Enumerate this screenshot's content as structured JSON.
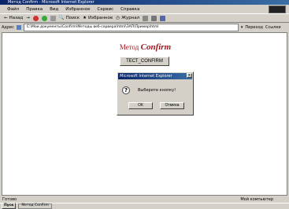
{
  "window": {
    "title": "Метод Confirm - Microsoft Internet Explorer"
  },
  "menu": [
    "Файл",
    "Правка",
    "Вид",
    "Избранное",
    "Сервис",
    "Справка"
  ],
  "toolbar": {
    "back": "Назад",
    "search": "Поиск",
    "favorites": "Избранное",
    "journal": "Журнал"
  },
  "address": {
    "label": "Адрес",
    "value": "C:\\Мои документы\\Confirm\\Методы веб-сервера\\html\\ЗАП\\Пример\\html",
    "go": "Переход",
    "links": "Ссылки"
  },
  "page": {
    "heading_prefix": "Метод",
    "heading_name": "Confirm",
    "test_button": "ТЕСТ_CONFIRM"
  },
  "dialog": {
    "title": "Microsoft Internet Explorer",
    "close": "×",
    "icon": "?",
    "message": "Выберите кнопку!",
    "ok": "ОК",
    "cancel": "Отмена"
  },
  "status": {
    "left": "Готово",
    "right": "Мой компьютер"
  },
  "taskbar": {
    "start": "Пуск",
    "task": "Метод Confirm"
  },
  "colors": {
    "accent": "#a01820",
    "title_bar": "#0a246a"
  }
}
